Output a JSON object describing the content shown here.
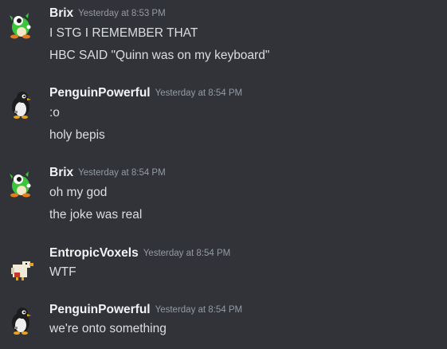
{
  "messages": [
    {
      "author": "Brix",
      "avatar_icon": "green-bubble-dragon-icon",
      "timestamp": "Yesterday at 8:53 PM",
      "lines": [
        "I STG I REMEMBER THAT",
        "HBC SAID \"Quinn was on my keyboard\""
      ]
    },
    {
      "author": "PenguinPowerful",
      "avatar_icon": "penguin-icon",
      "timestamp": "Yesterday at 8:54 PM",
      "lines": [
        ":o",
        "holy bepis"
      ]
    },
    {
      "author": "Brix",
      "avatar_icon": "green-bubble-dragon-icon",
      "timestamp": "Yesterday at 8:54 PM",
      "lines": [
        "oh my god",
        "the joke was real"
      ]
    },
    {
      "author": "EntropicVoxels",
      "avatar_icon": "voxel-bird-icon",
      "timestamp": "Yesterday at 8:54 PM",
      "lines": [
        "WTF"
      ]
    },
    {
      "author": "PenguinPowerful",
      "avatar_icon": "penguin-icon",
      "timestamp": "Yesterday at 8:54 PM",
      "lines": [
        "we're onto something"
      ]
    }
  ],
  "colors": {
    "background": "#313338",
    "username": "#f2f3f5",
    "timestamp": "#949ba4",
    "text": "#dbdee1"
  }
}
